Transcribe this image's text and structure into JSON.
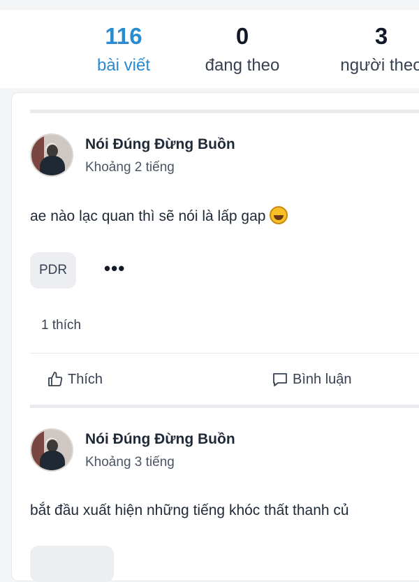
{
  "profile_stats": [
    {
      "value": "116",
      "label": "bài viết"
    },
    {
      "value": "0",
      "label": "đang theo"
    },
    {
      "value": "3",
      "label": "người theo"
    }
  ],
  "posts": [
    {
      "author": "Nói Đúng Đừng Buồn",
      "time": "Khoảng 2 tiếng",
      "content": "ae nào lạc quan thì sẽ nói là lấp gap",
      "emoji_icon": "rofl-emoji-icon",
      "tag": "PDR",
      "more_label": "•••",
      "likes": "1 thích",
      "actions": {
        "like": "Thích",
        "comment": "Bình luận"
      }
    },
    {
      "author": "Nói Đúng Đừng Buồn",
      "time": "Khoảng 3 tiếng",
      "content": "bắt đầu xuất hiện những tiếng khóc thất thanh củ"
    }
  ],
  "colors": {
    "accent": "#2a8bd0",
    "text": "#1f2937",
    "muted": "#4b5563"
  }
}
